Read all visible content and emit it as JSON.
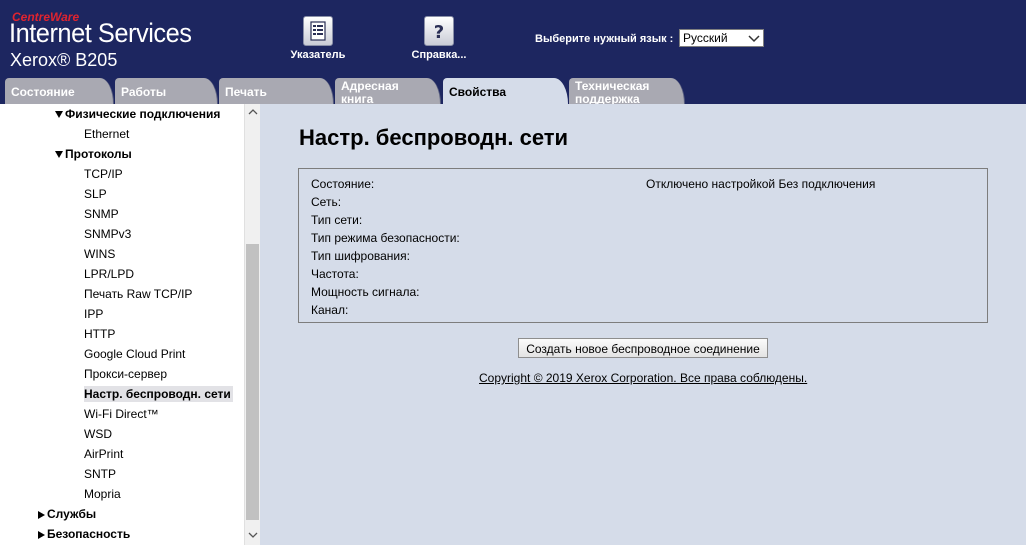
{
  "header": {
    "brand_small": "CentreWare",
    "brand_title": "Internet Services",
    "model": "Xerox® B205",
    "index_label": "Указатель",
    "help_label": "Справка...",
    "language_label": "Выберите нужный язык :",
    "language_value": "Русский"
  },
  "tabs": [
    {
      "label": "Состояние"
    },
    {
      "label": "Работы"
    },
    {
      "label": "Печать"
    },
    {
      "label": "Адресная книга"
    },
    {
      "label": "Свойства"
    },
    {
      "label": "Техническая поддержка"
    }
  ],
  "nav": {
    "physical": "Физические подключения",
    "ethernet": "Ethernet",
    "protocols": "Протоколы",
    "items": [
      "TCP/IP",
      "SLP",
      "SNMP",
      "SNMPv3",
      "WINS",
      "LPR/LPD",
      "Печать Raw TCP/IP",
      "IPP",
      "HTTP",
      "Google Cloud Print",
      "Прокси-сервер",
      "Настр. беспроводн. сети",
      "Wi-Fi Direct™",
      "WSD",
      "AirPrint",
      "SNTP",
      "Mopria"
    ],
    "services": "Службы",
    "security": "Безопасность"
  },
  "main": {
    "title": "Настр. беспроводн. сети",
    "rows": [
      {
        "label": "Состояние:",
        "value": "Отключено настройкой Без подключения"
      },
      {
        "label": "Сеть:",
        "value": ""
      },
      {
        "label": "Тип сети:",
        "value": ""
      },
      {
        "label": "Тип режима безопасности:",
        "value": ""
      },
      {
        "label": "Тип шифрования:",
        "value": ""
      },
      {
        "label": "Частота:",
        "value": ""
      },
      {
        "label": "Мощность сигнала:",
        "value": ""
      },
      {
        "label": "Канал:",
        "value": ""
      }
    ],
    "button_label": "Создать новое беспроводное соединение",
    "copyright": "Copyright © 2019 Xerox Corporation. Все права соблюдены."
  },
  "colors": {
    "header_bg": "#1d2660",
    "brand_red": "#e0242f",
    "tab_inactive": "#a9a9b2",
    "content_bg": "#d5dce9"
  }
}
